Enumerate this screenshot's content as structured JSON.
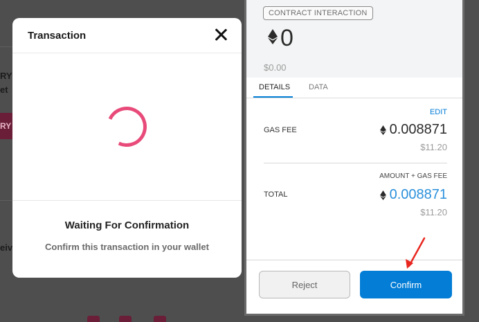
{
  "background": {
    "fragments": [
      "RY",
      "et",
      "RY",
      "eiv"
    ]
  },
  "transaction_modal": {
    "title": "Transaction",
    "status_title": "Waiting For Confirmation",
    "status_subtitle": "Confirm this transaction in your wallet",
    "spinner_color": "#e84b7a"
  },
  "wallet": {
    "badge": "CONTRACT INTERACTION",
    "amount": "0",
    "amount_usd": "$0.00",
    "tabs": [
      {
        "label": "DETAILS",
        "active": true
      },
      {
        "label": "DATA",
        "active": false
      }
    ],
    "edit_label": "EDIT",
    "gas_fee": {
      "label": "GAS FEE",
      "value": "0.008871",
      "usd": "$11.20"
    },
    "amount_gas_label": "AMOUNT + GAS FEE",
    "total": {
      "label": "TOTAL",
      "value": "0.008871",
      "usd": "$11.20"
    },
    "reject_label": "Reject",
    "confirm_label": "Confirm",
    "accent_color": "#037dd6"
  }
}
